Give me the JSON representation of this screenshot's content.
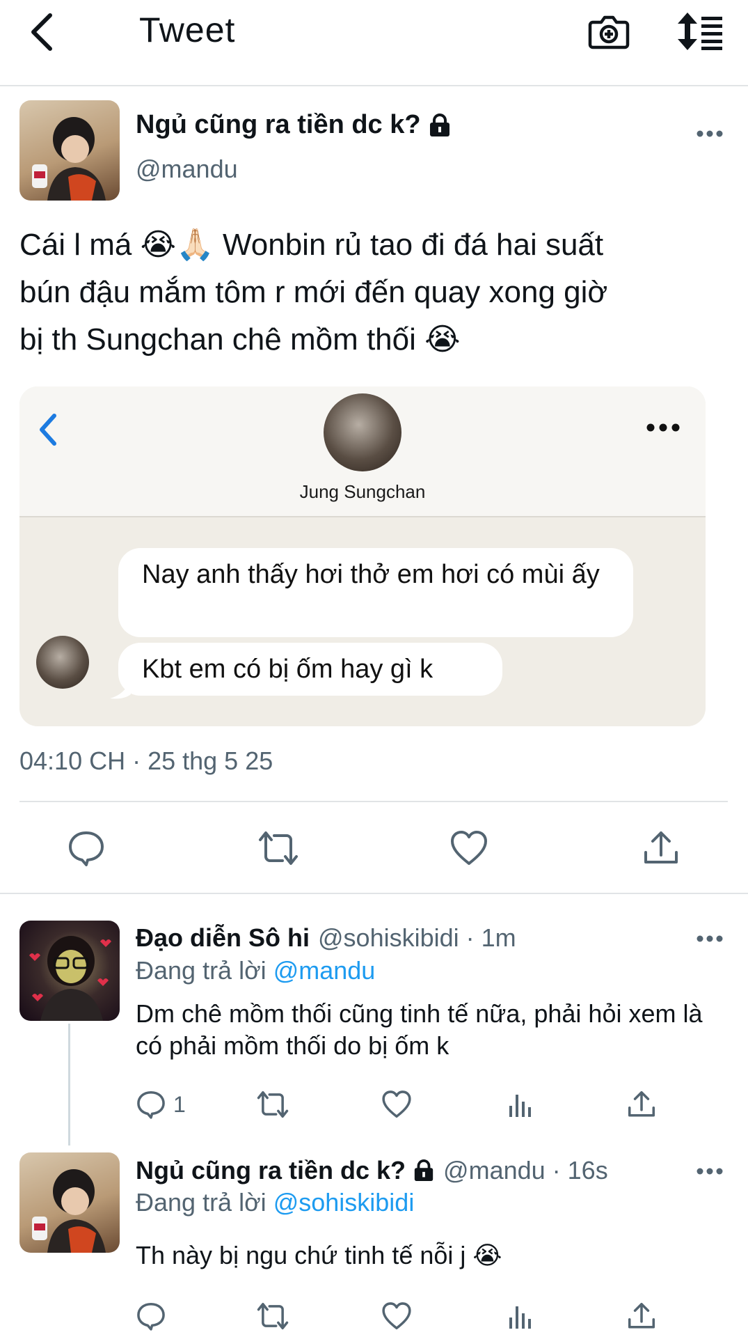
{
  "header": {
    "title": "Tweet"
  },
  "tweet": {
    "display_name": "Ngủ cũng ra tiền dc k?",
    "handle": "@mandu",
    "text_line1": "Cái l má 😭🙏🏻 Wonbin rủ tao đi đá hai suất",
    "text_line2": "bún đậu mắm tôm r mới đến quay xong giờ",
    "text_line3": "bị th Sungchan chê mồm thối 😭",
    "timestamp": "04:10 CH · 25 thg 5 25",
    "image": {
      "contact_name": "Jung Sungchan",
      "message1": "Nay anh thấy hơi thở em hơi có mùi ấy",
      "message2": "Kbt em có bị ốm hay gì k"
    }
  },
  "replies": [
    {
      "display_name": "Đạo diễn Sô hi",
      "meta": "@sohiskibidi · 1m",
      "replying_label": "Đang trả lời",
      "replying_to": "@mandu",
      "text": "Dm chê mồm thối cũng tinh tế nữa, phải hỏi xem là có phải mồm thối do bị ốm k",
      "reply_count": "1"
    },
    {
      "display_name": "Ngủ cũng ra tiền dc k?",
      "meta": "@mandu · 16s",
      "replying_label": "Đang trả lời",
      "replying_to": "@sohiskibidi",
      "text": "Th này bị ngu chứ tinh tế nỗi j 😭"
    }
  ],
  "colors": {
    "accent": "#1d9bf0",
    "secondary_text": "#536471",
    "divider": "#e1e4e6"
  }
}
